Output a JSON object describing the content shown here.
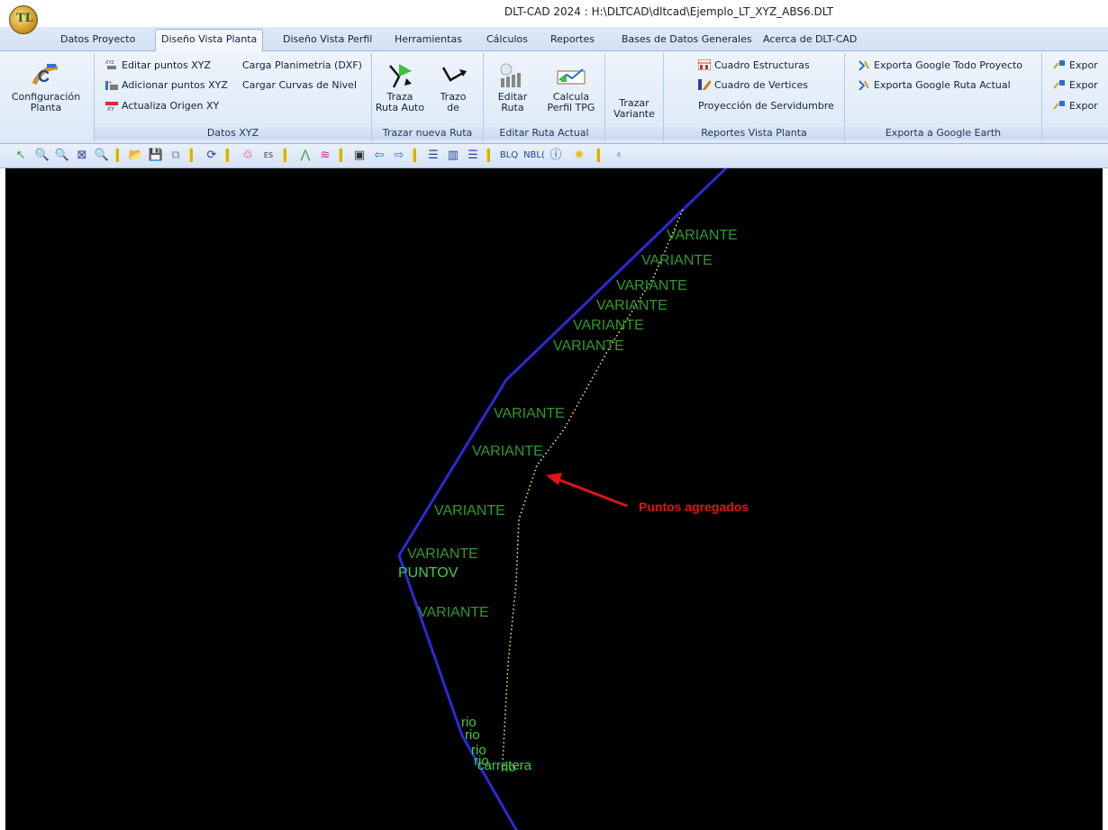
{
  "window": {
    "title": "DLT-CAD 2024 : H:\\DLTCAD\\dltcad\\Ejemplo_LT_XYZ_ABS6.DLT"
  },
  "tabs": [
    "Datos Proyecto",
    "Diseño Vista Planta",
    "Diseño Vista Perfil",
    "Herramientas",
    "Cálculos",
    "Reportes",
    "Bases de Datos Generales",
    "Acerca de DLT-CAD"
  ],
  "active_tab": "Diseño Vista Planta",
  "ribbon": {
    "config": {
      "label1": "Configuración",
      "label2": "Planta"
    },
    "datos_xyz": {
      "group_label": "Datos XYZ",
      "editar": "Editar puntos XYZ",
      "adicionar": "Adicionar puntos XYZ",
      "actualiza": "Actualiza Origen XY",
      "carga_plan": "Carga Planimetria (DXF)",
      "cargar_curvas": "Cargar Curvas de Nivel"
    },
    "trazar": {
      "group_label": "Trazar nueva Ruta",
      "traza_auto_1": "Traza",
      "traza_auto_2": "Ruta Auto",
      "trazo_de_1": "Trazo",
      "trazo_de_2": "de"
    },
    "editar_ruta": {
      "group_label": "Editar Ruta Actual",
      "editar_1": "Editar",
      "editar_2": "Ruta",
      "calcula_1": "Calcula",
      "calcula_2": "Perfil TPG"
    },
    "variante": {
      "label1": "Trazar",
      "label2": "Variante"
    },
    "reportes": {
      "group_label": "Reportes Vista Planta",
      "cuadro_estr": "Cuadro Estructuras",
      "cuadro_vert": "Cuadro de Vertices",
      "proyeccion": "Proyección de Servidumbre"
    },
    "google": {
      "group_label": "Exporta a Google Earth",
      "todo": "Exporta Google Todo Proyecto",
      "ruta": "Exporta Google Ruta Actual"
    },
    "expor": [
      "Expor",
      "Expor",
      "Expor"
    ]
  },
  "toolbar": {
    "blq": "BLQ",
    "nbl": "NBL("
  },
  "canvas": {
    "variante_label": "VARIANTE",
    "puntov_label": "PUNTOV",
    "rio_label": "rio",
    "carretera_label": "carretera",
    "annotation": "Puntos agregados",
    "colors": {
      "route": "#2a2ad8",
      "label": "#2f9a2f",
      "points": "#e6e66a",
      "arrow": "#e01414"
    }
  }
}
